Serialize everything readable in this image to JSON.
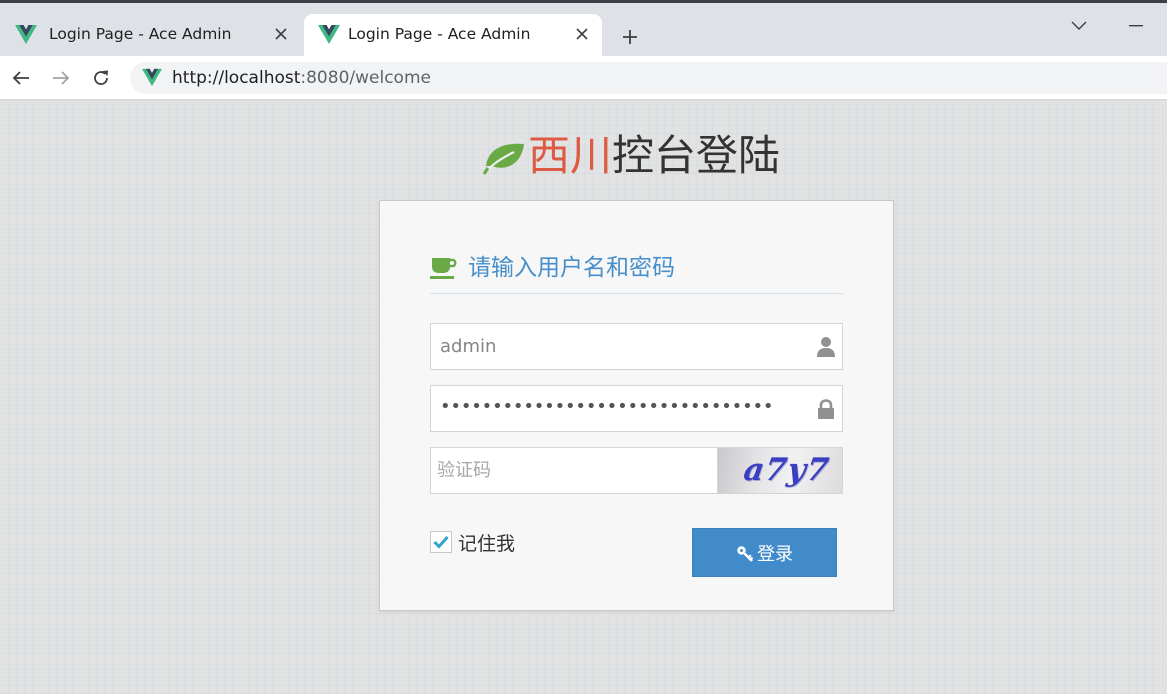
{
  "browser": {
    "tabs": [
      {
        "title": "Login Page - Ace Admin",
        "active": false
      },
      {
        "title": "Login Page - Ace Admin",
        "active": true
      }
    ],
    "url_host": "http://localhost",
    "url_rest": ":8080/welcome",
    "icons": {
      "favicon": "vue-logo-icon",
      "back": "back-arrow-icon",
      "forward": "forward-arrow-icon",
      "reload": "reload-icon",
      "new_tab": "plus-icon",
      "tab_search": "chevron-down-icon",
      "minimize": "minimize-icon"
    }
  },
  "page": {
    "heading_red": "西川",
    "heading_dark": "控台登陆",
    "box_title": "请输入用户名和密码",
    "username_value": "admin",
    "password_mask": "••••••••••••••••••••••••••••••••",
    "captcha_placeholder": "验证码",
    "captcha_text": "a7y7",
    "remember_label": "记住我",
    "remember_checked": true,
    "login_label": "登录",
    "icons": {
      "heading": "leaf-icon",
      "box_title": "coffee-icon",
      "username": "user-icon",
      "password": "lock-icon",
      "remember": "checkmark-icon",
      "login": "key-icon"
    }
  },
  "colors": {
    "heading_red": "#dd5a43",
    "leaf_green": "#69aa46",
    "title_blue": "#478fca",
    "button_blue": "#428bca"
  }
}
